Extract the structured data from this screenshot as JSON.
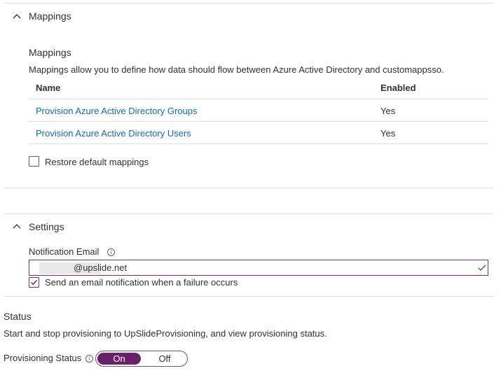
{
  "mappings_section": {
    "header": "Mappings",
    "subtitle": "Mappings",
    "description": "Mappings allow you to define how data should flow between Azure Active Directory and customappsso.",
    "columns": {
      "name": "Name",
      "enabled": "Enabled"
    },
    "rows": [
      {
        "name": "Provision Azure Active Directory Groups",
        "enabled": "Yes"
      },
      {
        "name": "Provision Azure Active Directory Users",
        "enabled": "Yes"
      }
    ],
    "restore_label": "Restore default mappings",
    "restore_checked": false
  },
  "settings_section": {
    "header": "Settings",
    "notification_email_label": "Notification Email",
    "email_value": "@upslide.net",
    "send_email_label": "Send an email notification when a failure occurs",
    "send_email_checked": true
  },
  "status_section": {
    "title": "Status",
    "description": "Start and stop provisioning to UpSlideProvisioning, and view provisioning status.",
    "provisioning_label": "Provisioning Status",
    "toggle_on": "On",
    "toggle_off": "Off",
    "selected": "On"
  },
  "colors": {
    "accent": "#6b1f6b",
    "link": "#0f6cbd",
    "valid_check": "#107c10"
  },
  "icons": [
    "chevron-up-icon",
    "info-icon",
    "checkmark-icon"
  ]
}
